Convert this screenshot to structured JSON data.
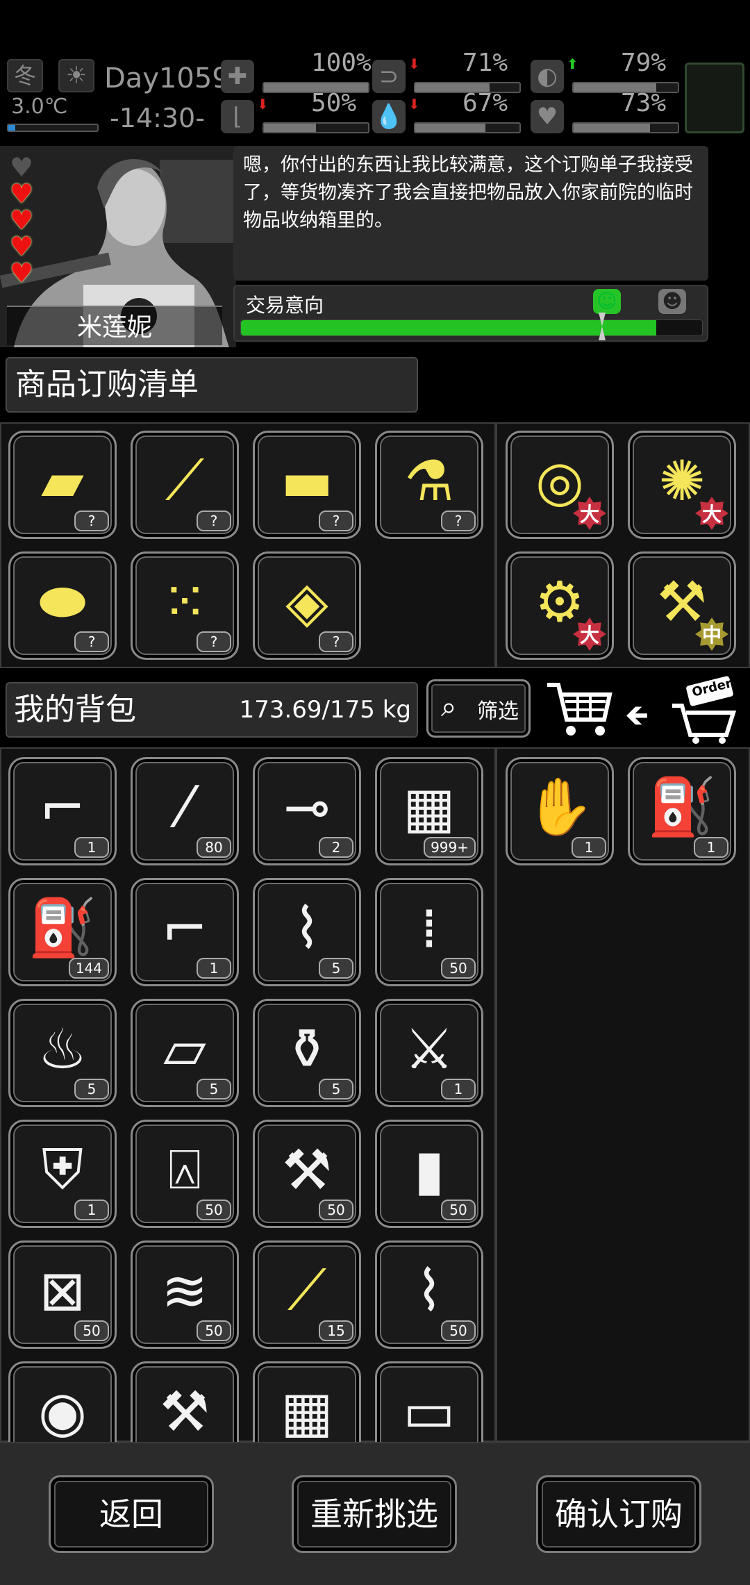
{
  "status": {
    "season": "冬",
    "weather_icon": "sun-icon",
    "temperature": "3.0℃",
    "day": "Day1059",
    "time": "-14:30-",
    "stats": [
      {
        "name": "health",
        "icon": "medkit-icon",
        "value": "100%",
        "level": 1.0,
        "trend": ""
      },
      {
        "name": "hunger",
        "icon": "stomach-icon",
        "value": "71%",
        "level": 0.71,
        "trend": "down"
      },
      {
        "name": "energy",
        "icon": "pill-icon",
        "value": "79%",
        "level": 0.79,
        "trend": "up"
      },
      {
        "name": "fatigue",
        "icon": "boot-icon",
        "value": "50%",
        "level": 0.5,
        "trend": "down"
      },
      {
        "name": "thirst",
        "icon": "water-drop-icon",
        "value": "67%",
        "level": 0.67,
        "trend": "down"
      },
      {
        "name": "mood",
        "icon": "heart-icon",
        "value": "73%",
        "level": 0.73,
        "trend": ""
      }
    ]
  },
  "character": {
    "name": "米莲妮",
    "hearts_filled": 4,
    "hearts_total": 5,
    "dialog": "嗯，你付出的东西让我比较满意，这个订购单子我接受了，等货物凑齐了我会直接把物品放入你家前院的临时物品收纳箱里的。",
    "trade_label": "交易意向",
    "trade_level": 0.9
  },
  "order": {
    "title": "商品订购清单",
    "left_items": [
      {
        "name": "wood-planks-icon",
        "glyph": "▰",
        "qty": "?"
      },
      {
        "name": "sticks-icon",
        "glyph": "⟋",
        "qty": "?"
      },
      {
        "name": "cloth-icon",
        "glyph": "▬",
        "qty": "?"
      },
      {
        "name": "flask-icon",
        "glyph": "⚗",
        "qty": "?"
      },
      {
        "name": "pipe-fitting-icon",
        "glyph": "⬬",
        "qty": "?"
      },
      {
        "name": "scrap-pieces-icon",
        "glyph": "⁙",
        "qty": "?"
      },
      {
        "name": "metal-plate-icon",
        "glyph": "◈",
        "qty": "?"
      }
    ],
    "right_items": [
      {
        "name": "tape-roll-icon",
        "glyph": "◎",
        "badge": "大",
        "badge_color": "red"
      },
      {
        "name": "cotton-icon",
        "glyph": "✺",
        "badge": "大",
        "badge_color": "red"
      },
      {
        "name": "gears-icon",
        "glyph": "⚙",
        "badge": "大",
        "badge_color": "red"
      },
      {
        "name": "parts-pile-icon",
        "glyph": "⚒",
        "badge": "中",
        "badge_color": "gold"
      }
    ]
  },
  "backpack": {
    "title": "我的背包",
    "weight": "173.69/175 kg",
    "filter_label": "筛选",
    "items": [
      {
        "name": "sniper-rifle-icon",
        "glyph": "⌐",
        "qty": "1"
      },
      {
        "name": "bullets-icon",
        "glyph": "⁄",
        "qty": "80"
      },
      {
        "name": "syringe-icon",
        "glyph": "⊸",
        "qty": "2"
      },
      {
        "name": "card-icon",
        "glyph": "▦",
        "qty": "999+"
      },
      {
        "name": "spray-cans-icon",
        "glyph": "⛽",
        "qty": "144"
      },
      {
        "name": "flare-gun-icon",
        "glyph": "⌐",
        "qty": "1"
      },
      {
        "name": "bandage-icon",
        "glyph": "⌇",
        "qty": "5"
      },
      {
        "name": "shells-icon",
        "glyph": "⁞",
        "qty": "50"
      },
      {
        "name": "grenade-icon",
        "glyph": "♨",
        "qty": "5"
      },
      {
        "name": "gold-bars-icon",
        "glyph": "▱",
        "qty": "5"
      },
      {
        "name": "vase-icon",
        "glyph": "⚱",
        "qty": "5"
      },
      {
        "name": "knife-icon",
        "glyph": "⚔",
        "qty": "1"
      },
      {
        "name": "armor-vest-icon",
        "glyph": "⛨",
        "qty": "1"
      },
      {
        "name": "plastic-bottle-icon",
        "glyph": "⍓",
        "qty": "50"
      },
      {
        "name": "screws-icon",
        "glyph": "⚒",
        "qty": "50"
      },
      {
        "name": "batteries-icon",
        "glyph": "▮",
        "qty": "50"
      },
      {
        "name": "fuel-can-icon",
        "glyph": "⊠",
        "qty": "50"
      },
      {
        "name": "fabric-icon",
        "glyph": "≋",
        "qty": "50"
      },
      {
        "name": "sticks-icon",
        "glyph": "⟋",
        "qty": "15"
      },
      {
        "name": "scrap-metal-icon",
        "glyph": "⌇",
        "qty": "50"
      },
      {
        "name": "logs-icon",
        "glyph": "◉",
        "qty": ""
      },
      {
        "name": "tools-icon",
        "glyph": "⚒",
        "qty": ""
      },
      {
        "name": "blocks-icon",
        "glyph": "▦",
        "qty": ""
      },
      {
        "name": "board-icon",
        "glyph": "▭",
        "qty": ""
      }
    ],
    "offer_items": [
      {
        "name": "gloves-icon",
        "glyph": "✋",
        "qty": "1"
      },
      {
        "name": "spray-cans-icon",
        "glyph": "⛽",
        "qty": "1"
      }
    ]
  },
  "buttons": {
    "back": "返回",
    "reselect": "重新挑选",
    "confirm": "确认订购"
  },
  "order_tag": "Order"
}
